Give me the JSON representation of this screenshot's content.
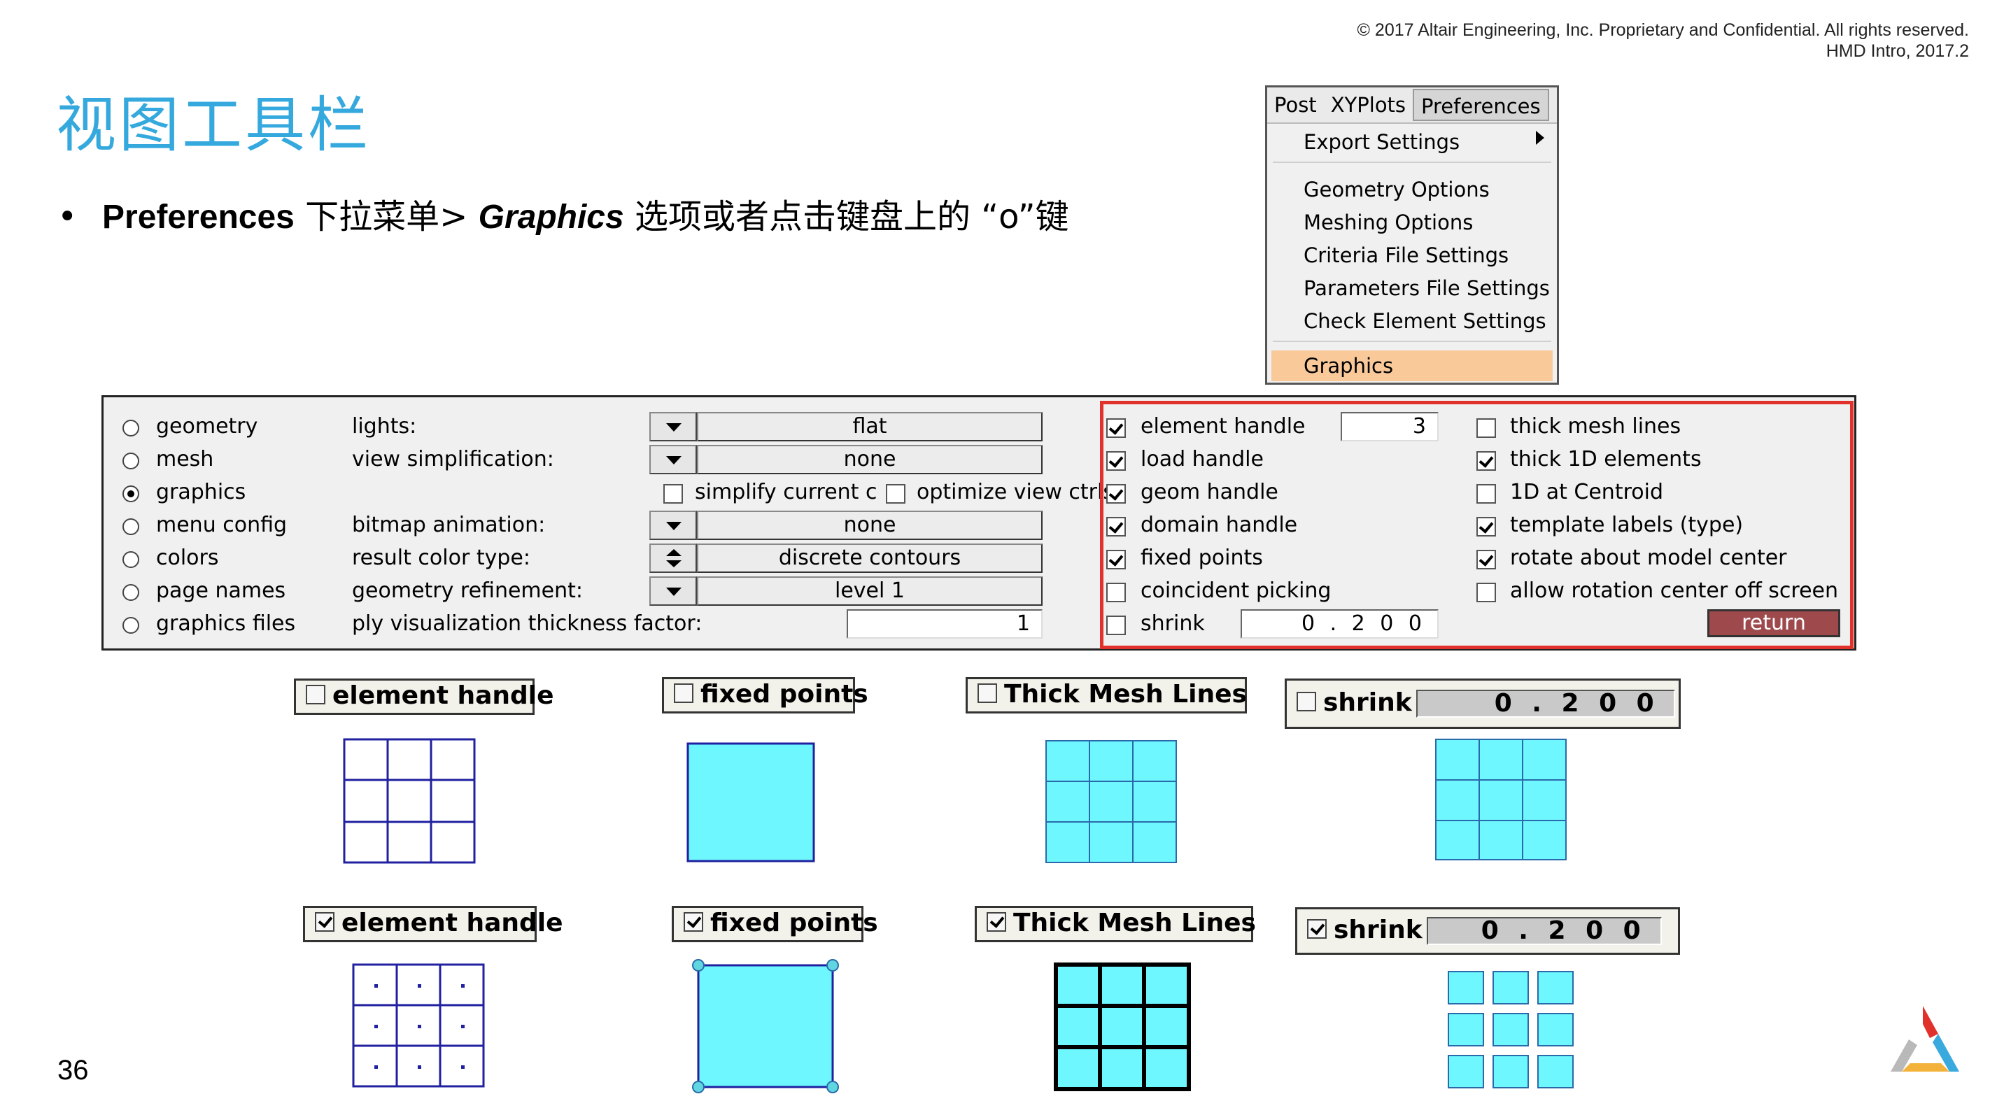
{
  "header": {
    "copyright": "© 2017 Altair Engineering, Inc. Proprietary and Confidential. All rights reserved.",
    "version": "HMD Intro, 2017.2"
  },
  "title": "视图工具栏",
  "bullet": {
    "part1": "Preferences",
    "part2": " 下拉菜单> ",
    "part3": "Graphics",
    "part4": " 选项或者点击键盘上的 “o”键"
  },
  "page_number": "36",
  "menu": {
    "tabs": [
      "Post",
      "XYPlots",
      "Preferences"
    ],
    "items": [
      "Export Settings",
      "Geometry Options",
      "Meshing Options",
      "Criteria File Settings",
      "Parameters File Settings",
      "Check Element Settings",
      "Graphics"
    ]
  },
  "panel": {
    "radios": [
      {
        "label": "geometry",
        "selected": false
      },
      {
        "label": "mesh",
        "selected": false
      },
      {
        "label": "graphics",
        "selected": true
      },
      {
        "label": "menu config",
        "selected": false
      },
      {
        "label": "colors",
        "selected": false
      },
      {
        "label": "page names",
        "selected": false
      },
      {
        "label": "graphics files",
        "selected": false
      }
    ],
    "settings": {
      "lights_label": "lights:",
      "lights_value": "flat",
      "viewsimp_label": "view simplification:",
      "viewsimp_value": "none",
      "simplify_current": "simplify current c",
      "optimize_view": "optimize view ctrls",
      "bitmap_label": "bitmap animation:",
      "bitmap_value": "none",
      "resultcolor_label": "result color type:",
      "resultcolor_value": "discrete contours",
      "georef_label": "geometry refinement:",
      "georef_value": "level  1",
      "ply_label": "ply visualization thickness factor:",
      "ply_value": "1"
    },
    "checks_left": [
      {
        "label": "element handle",
        "checked": true
      },
      {
        "label": "load handle",
        "checked": true
      },
      {
        "label": "geom handle",
        "checked": true
      },
      {
        "label": "domain handle",
        "checked": true
      },
      {
        "label": "fixed points",
        "checked": true
      },
      {
        "label": "coincident picking",
        "checked": false
      },
      {
        "label": "shrink",
        "checked": false
      }
    ],
    "element_handle_value": "3",
    "shrink_value": "0 . 2 0 0",
    "checks_right": [
      {
        "label": "thick mesh lines",
        "checked": false
      },
      {
        "label": "thick 1D elements",
        "checked": true
      },
      {
        "label": "1D at Centroid",
        "checked": false
      },
      {
        "label": "template labels (type)",
        "checked": true
      },
      {
        "label": "rotate about model center",
        "checked": true
      },
      {
        "label": "allow rotation center off screen",
        "checked": false
      }
    ],
    "return_label": "return"
  },
  "demos": {
    "element_handle": "element handle",
    "fixed_points": "fixed points",
    "thick_mesh_lines": "Thick Mesh Lines",
    "shrink": "shrink",
    "shrink_value": "0 . 2 0 0"
  },
  "colors": {
    "title": "#35a9de",
    "mesh_fill": "#6ff7ff",
    "mesh_line_blue": "#2020a0",
    "highlight_box": "#e0312b",
    "menu_highlight": "#f9c99a",
    "return_button": "#9e4a4d"
  }
}
